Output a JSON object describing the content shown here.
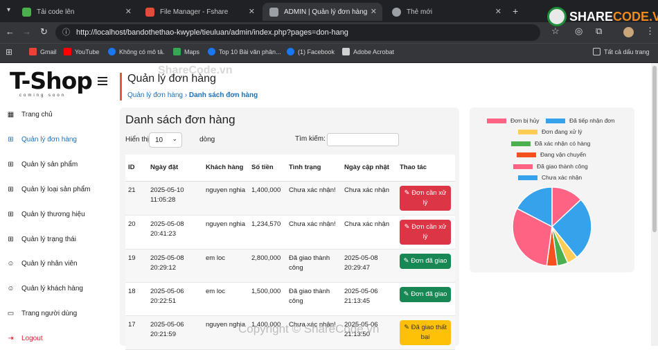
{
  "browser": {
    "tabs": [
      {
        "label": "Tải code lên",
        "color": "#4caf50"
      },
      {
        "label": "File Manager - Fshare",
        "color": "#e34b3a"
      },
      {
        "label": "ADMIN | Quản lý đơn hàng",
        "color": "#9aa0a6"
      },
      {
        "label": "Thẻ mới",
        "color": "#9aa0a6"
      }
    ],
    "url": "http://localhost/bandothethao-kwyple/tieuluan/admin/index.php?pages=don-hang",
    "bookmarks": [
      "Gmail",
      "YouTube",
      "Không có mô tả.",
      "Maps",
      "Top 10 Bài văn phân...",
      "(1) Facebook",
      "Adobe Acrobat"
    ],
    "bookmark_colors": [
      "#ea4335",
      "#ff0000",
      "#1877f2",
      "#34a853",
      "#1877f2",
      "#1877f2",
      "#d0d0d0"
    ],
    "all_bookmarks": "Tất cả dấu trang"
  },
  "watermarks": {
    "top": "ShareCode.vn",
    "bottom": "Copyright © ShareCode.vn",
    "logo_share": "SHARE",
    "logo_code": "CODE.VN"
  },
  "sidebar": {
    "logo": "T-Shop",
    "logo_sub": "coming soon",
    "items": [
      {
        "label": "Trang chủ",
        "icon": "dashboard-icon"
      },
      {
        "label": "Quản lý đơn hàng",
        "icon": "grid-icon",
        "active": true
      },
      {
        "label": "Quản lý sản phẩm",
        "icon": "grid-icon"
      },
      {
        "label": "Quản lý loại sản phẩm",
        "icon": "grid-icon"
      },
      {
        "label": "Quản lý thương hiệu",
        "icon": "grid-icon"
      },
      {
        "label": "Quản lý trạng thái",
        "icon": "grid-icon"
      },
      {
        "label": "Quản lý nhân viên",
        "icon": "users-icon"
      },
      {
        "label": "Quản lý khách hàng",
        "icon": "users-icon"
      },
      {
        "label": "Trang người dùng",
        "icon": "monitor-icon"
      },
      {
        "label": "Logout",
        "icon": "logout-icon"
      }
    ]
  },
  "page": {
    "title": "Quản lý đơn hàng",
    "crumb_parent": "Quản lý đơn hàng",
    "crumb_sep": "›",
    "crumb_current": "Danh sách đơn hàng"
  },
  "list": {
    "title": "Danh sách đơn hàng",
    "show_label": "Hiển thị",
    "show_value": "10",
    "show_suffix": "dòng",
    "search_label": "Tìm kiếm:",
    "headers": [
      "ID",
      "Ngày đặt",
      "Khách hàng",
      "Số tiền",
      "Tình trạng",
      "Ngày cập nhật",
      "Thao tác"
    ],
    "rows": [
      {
        "id": "21",
        "date": "2025-05-10 11:05:28",
        "customer": "nguyen nghia",
        "amount": "1,400,000",
        "status": "Chưa xác nhận!",
        "updated": "Chưa xác nhận",
        "action": "✎ Đơn cần xử lý",
        "style": "red"
      },
      {
        "id": "20",
        "date": "2025-05-08 20:41:23",
        "customer": "nguyen nghia",
        "amount": "1,234,570",
        "status": "Chưa xác nhận!",
        "updated": "Chưa xác nhận",
        "action": "✎ Đơn cần xử lý",
        "style": "red"
      },
      {
        "id": "19",
        "date": "2025-05-08 20:29:12",
        "customer": "em loc",
        "amount": "2,800,000",
        "status": "Đã giao thành công",
        "updated": "2025-05-08 20:29:47",
        "action": "✎ Đơn đã giao",
        "style": "green"
      },
      {
        "id": "18",
        "date": "2025-05-06 20:22:51",
        "customer": "em loc",
        "amount": "1,500,000",
        "status": "Đã giao thành công",
        "updated": "2025-05-06 21:13:45",
        "action": "✎ Đơn đã giao",
        "style": "green"
      },
      {
        "id": "17",
        "date": "2025-05-06 20:21:59",
        "customer": "nguyen nghia",
        "amount": "1,400,000",
        "status": "Chưa xác nhận!",
        "updated": "2025-05-06 21:13:50",
        "action": "✎ Đã giao thất bại",
        "style": "yellow"
      }
    ]
  },
  "chart_data": {
    "type": "pie",
    "title": "",
    "legend_position": "top",
    "series": [
      {
        "name": "Đơn bị hủy",
        "value": 3,
        "color": "#ff6384"
      },
      {
        "name": "Đã tiếp nhận đơn",
        "value": 6,
        "color": "#36a2eb"
      },
      {
        "name": "Đơn đang xử lý",
        "value": 1,
        "color": "#ffcd56"
      },
      {
        "name": "Đã xác nhận có hàng",
        "value": 1,
        "color": "#4caf50"
      },
      {
        "name": "Đang vận chuyển",
        "value": 1,
        "color": "#f4511e"
      },
      {
        "name": "Đã giao thành công",
        "value": 7,
        "color": "#ff6384"
      },
      {
        "name": "Chưa xác nhận",
        "value": 4,
        "color": "#36a2eb"
      }
    ]
  }
}
